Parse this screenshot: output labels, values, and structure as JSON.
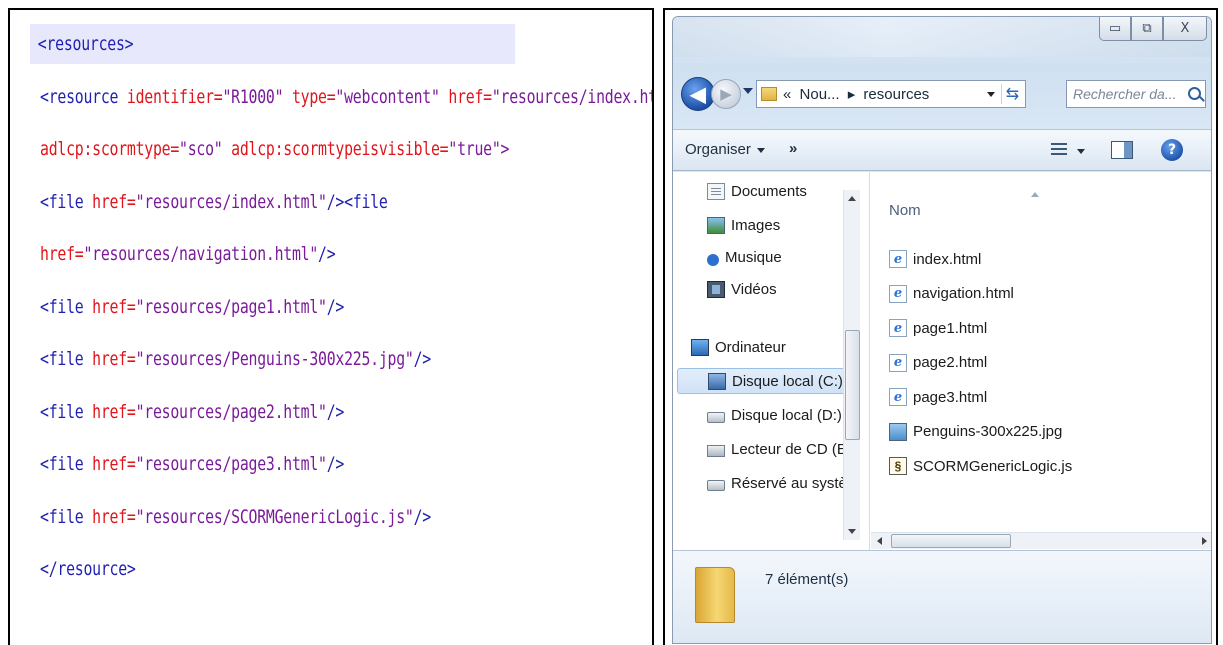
{
  "code": {
    "lines": [
      [
        {
          "t": "<resources>",
          "c": "tag"
        }
      ],
      [
        {
          "t": "<resource ",
          "c": "tag"
        },
        {
          "t": "identifier=",
          "c": "attr"
        },
        {
          "t": "\"R1000\" ",
          "c": "val"
        },
        {
          "t": "type=",
          "c": "attr"
        },
        {
          "t": "\"webcontent\" ",
          "c": "val"
        },
        {
          "t": "href=",
          "c": "attr"
        },
        {
          "t": "\"resources/index.html",
          "c": "val"
        }
      ],
      [
        {
          "t": "adlcp:scormtype=",
          "c": "attr"
        },
        {
          "t": "\"sco\" ",
          "c": "val"
        },
        {
          "t": "adlcp:scormtypeisvisible=",
          "c": "attr"
        },
        {
          "t": "\"true\">",
          "c": "val"
        }
      ],
      [
        {
          "t": "<file ",
          "c": "tag"
        },
        {
          "t": "href=",
          "c": "attr"
        },
        {
          "t": "\"resources/index.html\"",
          "c": "val"
        },
        {
          "t": "/><file",
          "c": "tag"
        }
      ],
      [
        {
          "t": "href=",
          "c": "attr"
        },
        {
          "t": "\"resources/navigation.html\"",
          "c": "val"
        },
        {
          "t": "/>",
          "c": "tag"
        }
      ],
      [
        {
          "t": "<file ",
          "c": "tag"
        },
        {
          "t": "href=",
          "c": "attr"
        },
        {
          "t": "\"resources/page1.html\"",
          "c": "val"
        },
        {
          "t": "/>",
          "c": "tag"
        }
      ],
      [
        {
          "t": "<file ",
          "c": "tag"
        },
        {
          "t": "href=",
          "c": "attr"
        },
        {
          "t": "\"resources/Penguins-300x225.jpg\"",
          "c": "val"
        },
        {
          "t": "/>",
          "c": "tag"
        }
      ],
      [
        {
          "t": "<file ",
          "c": "tag"
        },
        {
          "t": "href=",
          "c": "attr"
        },
        {
          "t": "\"resources/page2.html\"",
          "c": "val"
        },
        {
          "t": "/>",
          "c": "tag"
        }
      ],
      [
        {
          "t": "<file ",
          "c": "tag"
        },
        {
          "t": "href=",
          "c": "attr"
        },
        {
          "t": "\"resources/page3.html\"",
          "c": "val"
        },
        {
          "t": "/>",
          "c": "tag"
        }
      ],
      [
        {
          "t": "<file ",
          "c": "tag"
        },
        {
          "t": "href=",
          "c": "attr"
        },
        {
          "t": "\"resources/SCORMGenericLogic.js\"",
          "c": "val"
        },
        {
          "t": "/>",
          "c": "tag"
        }
      ],
      [
        {
          "t": "</resource>",
          "c": "tag"
        }
      ]
    ],
    "colors": {
      "tag": "#1f1fb0",
      "attr": "#e0141a",
      "val": "#7a1a9a",
      "highlight": "#e7e8fb"
    }
  },
  "explorer": {
    "caption": {
      "minimize": "▭",
      "maximize": "⧉",
      "close": "X"
    },
    "nav": {
      "back": "◀",
      "forward": "▶"
    },
    "address": {
      "prefix": "«",
      "part1": "Nou...",
      "sep": "▸",
      "part2": "resources"
    },
    "search_placeholder": "Rechercher da...",
    "toolbar": {
      "organize": "Organiser",
      "more": "»",
      "help": "?"
    },
    "nav_pane": [
      {
        "label": "Documents",
        "icon": "documents-icon",
        "cls": "ic-doc"
      },
      {
        "label": "Images",
        "icon": "images-icon",
        "cls": "ic-img"
      },
      {
        "label": "Musique",
        "icon": "music-icon",
        "cls": "ic-music"
      },
      {
        "label": "Vidéos",
        "icon": "videos-icon",
        "cls": "ic-video"
      },
      {
        "label": "Ordinateur",
        "icon": "computer-icon",
        "cls": "ic-pc"
      },
      {
        "label": "Disque local (C:)",
        "icon": "local-disk-c-icon",
        "cls": "ic-disk-c",
        "selected": true
      },
      {
        "label": "Disque local (D:)",
        "icon": "local-disk-d-icon",
        "cls": "ic-disk"
      },
      {
        "label": "Lecteur de CD (E:",
        "icon": "cd-drive-icon",
        "cls": "ic-cd"
      },
      {
        "label": "Réservé au systèr",
        "icon": "system-reserved-icon",
        "cls": "ic-disk"
      }
    ],
    "column_header": "Nom",
    "files": [
      {
        "name": "index.html",
        "icon": "ie-html-icon",
        "kind": "ie"
      },
      {
        "name": "navigation.html",
        "icon": "ie-html-icon",
        "kind": "ie"
      },
      {
        "name": "page1.html",
        "icon": "ie-html-icon",
        "kind": "ie"
      },
      {
        "name": "page2.html",
        "icon": "ie-html-icon",
        "kind": "ie"
      },
      {
        "name": "page3.html",
        "icon": "ie-html-icon",
        "kind": "ie"
      },
      {
        "name": "Penguins-300x225.jpg",
        "icon": "jpg-image-icon",
        "kind": "jpg"
      },
      {
        "name": "SCORMGenericLogic.js",
        "icon": "js-script-icon",
        "kind": "js"
      }
    ],
    "status": "7 élément(s)"
  }
}
